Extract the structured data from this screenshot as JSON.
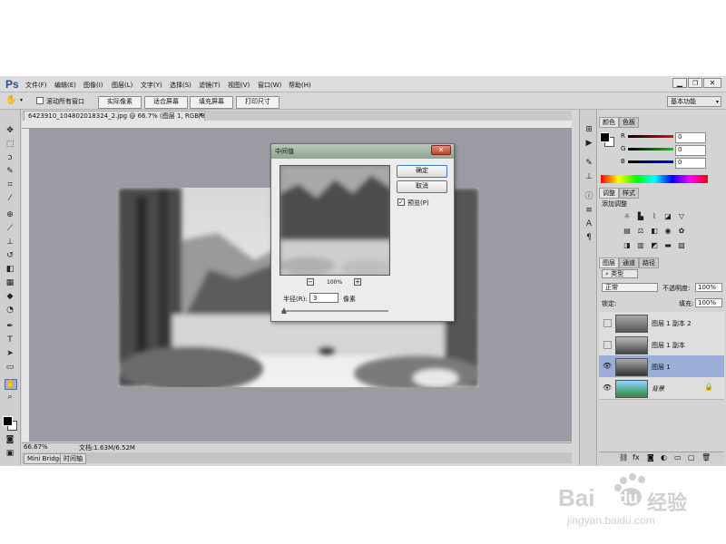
{
  "app": {
    "logo": "Ps"
  },
  "menu": [
    "文件(F)",
    "编辑(E)",
    "图像(I)",
    "图层(L)",
    "文字(Y)",
    "选择(S)",
    "滤镜(T)",
    "视图(V)",
    "窗口(W)",
    "帮助(H)"
  ],
  "options": {
    "scroll_all_label": "滚动所有窗口",
    "btn_actual": "实际像素",
    "btn_fit": "适合屏幕",
    "btn_fill": "填充屏幕",
    "btn_print": "打印尺寸",
    "workspace": "基本功能"
  },
  "document": {
    "tab": "6423910_104802018324_2.jpg @ 66.7% (图层 1, RGB/8#) *",
    "zoom": "66.67%",
    "doc_size": "文档:1.63M/6.52M"
  },
  "bottom_tabs": [
    "Mini Bridge",
    "时间轴"
  ],
  "color_panel": {
    "tab_color": "颜色",
    "tab_swatches": "色板",
    "r_label": "R",
    "g_label": "G",
    "b_label": "B",
    "r_value": "0",
    "g_value": "0",
    "b_value": "0"
  },
  "adjust_panel": {
    "tab_adjust": "调整",
    "tab_styles": "样式",
    "add_label": "添加调整"
  },
  "layers_panel": {
    "tab_layers": "图层",
    "tab_channels": "通道",
    "tab_paths": "路径",
    "kind_filter": "类型",
    "blend_mode": "正常",
    "opacity_label": "不透明度:",
    "opacity_value": "100%",
    "lock_label": "锁定:",
    "fill_label": "填充:",
    "fill_value": "100%",
    "layers": [
      {
        "name": "图层 1 副本 2",
        "visible": false,
        "selected": false
      },
      {
        "name": "图层 1 副本",
        "visible": false,
        "selected": false
      },
      {
        "name": "图层 1",
        "visible": true,
        "selected": true
      },
      {
        "name": "背景",
        "visible": true,
        "selected": false
      }
    ]
  },
  "dialog": {
    "title": "中间值",
    "ok": "确定",
    "cancel": "取消",
    "preview_label": "预览(P)",
    "zoom": "100%",
    "radius_label": "半径(R):",
    "radius_value": "3",
    "unit": "像素"
  },
  "watermark": {
    "brand": "Bai",
    "brand2": "du",
    "brand_cn": "经验",
    "url": "jingyan.baidu.com"
  }
}
